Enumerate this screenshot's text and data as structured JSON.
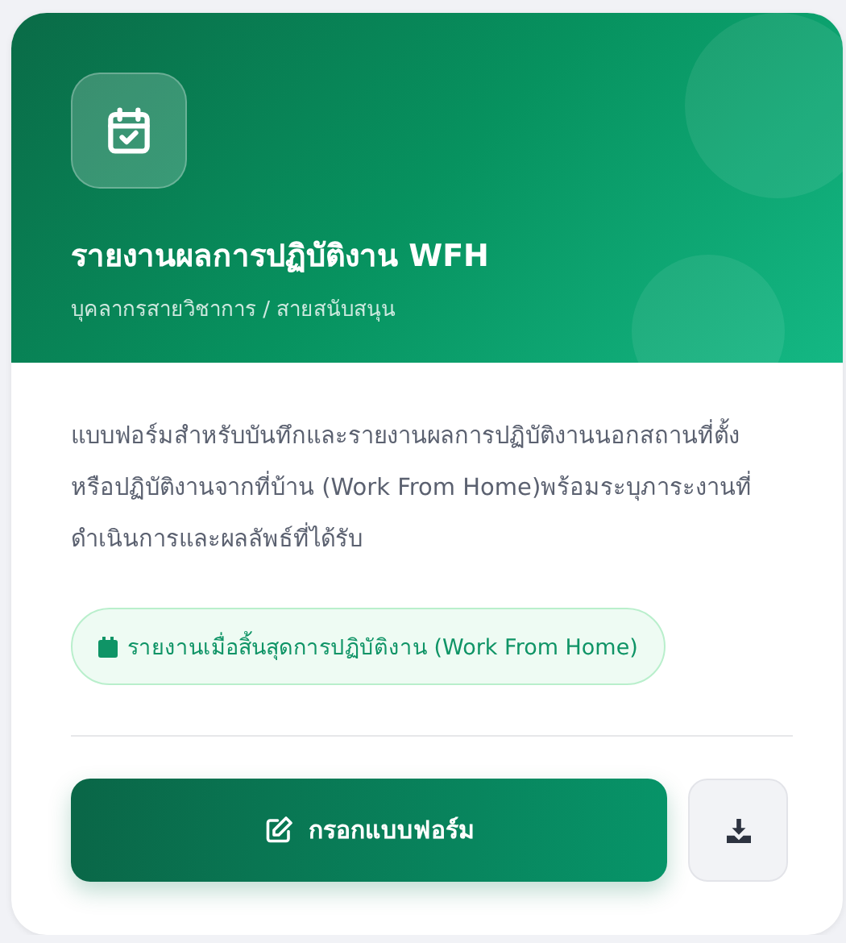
{
  "card": {
    "title": "รายงานผลการปฏิบัติงาน WFH",
    "subtitle": "บุคลากรสายวิชาการ / สายสนับสนุน",
    "description": "แบบฟอร์มสำหรับบันทึกและรายงานผลการปฏิบัติงานนอกสถานที่ตั้ง หรือปฏิบัติงานจากที่บ้าน (Work From Home)พร้อมระบุภาระงานที่ดำเนินการและผลลัพธ์ที่ได้รับ",
    "badge": "รายงานเมื่อสิ้นสุดการปฏิบัติงาน (Work From Home)",
    "primary_button": "กรอกแบบฟอร์ม"
  }
}
